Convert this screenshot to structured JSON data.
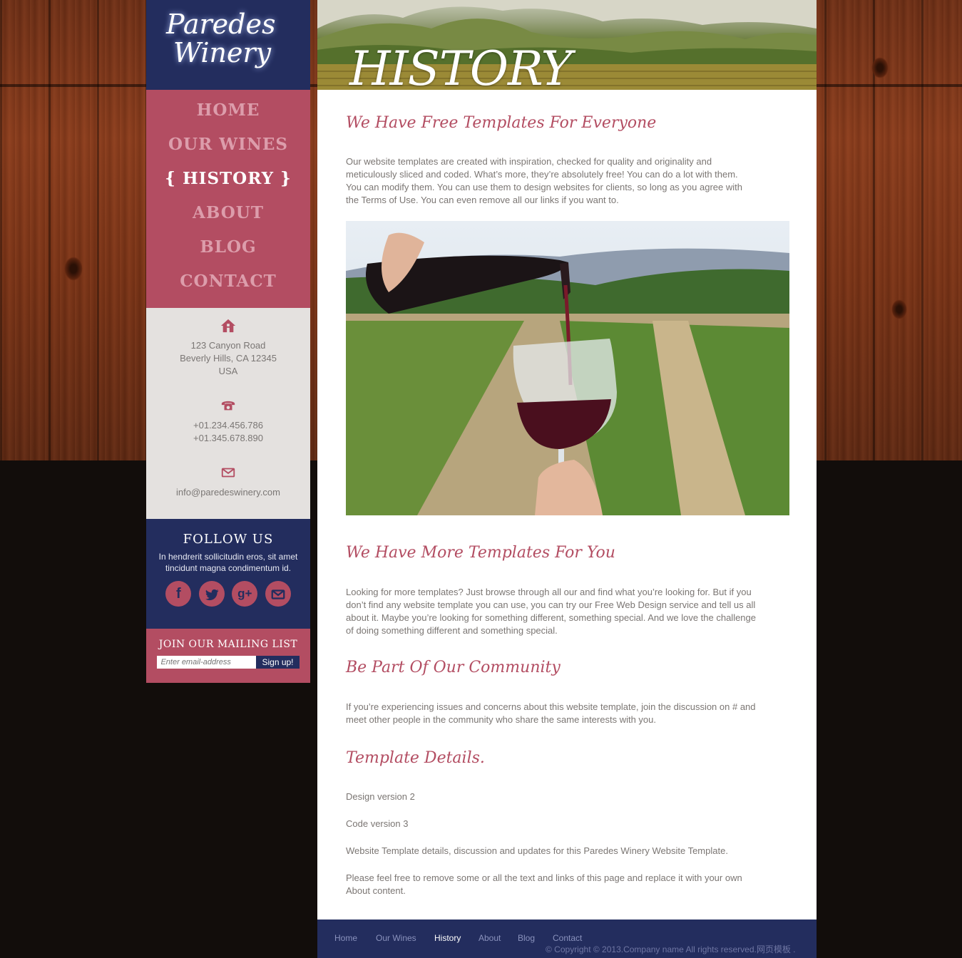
{
  "logo": {
    "line1": "Paredes",
    "line2": "Winery"
  },
  "nav": {
    "items": [
      {
        "label": "HOME"
      },
      {
        "label": "OUR WINES"
      },
      {
        "label": "{ HISTORY }"
      },
      {
        "label": "ABOUT"
      },
      {
        "label": "BLOG"
      },
      {
        "label": "CONTACT"
      }
    ]
  },
  "contact": {
    "address": [
      "123 Canyon Road",
      "Beverly Hills, CA 12345",
      "USA"
    ],
    "phones": [
      "+01.234.456.786",
      "+01.345.678.890"
    ],
    "email": "info@paredeswinery.com"
  },
  "follow": {
    "title": "FOLLOW US",
    "text": "In hendrerit sollicitudin eros, sit amet tincidunt magna condimentum id.",
    "icons": [
      "facebook-icon",
      "twitter-icon",
      "google-plus-icon",
      "mail-icon"
    ]
  },
  "mailing": {
    "title": "JOIN OUR MAILING LIST",
    "placeholder": "Enter email-address",
    "button": "Sign up!"
  },
  "banner": {
    "title": "HISTORY"
  },
  "sections": [
    {
      "heading": "We Have Free Templates For Everyone",
      "body": "Our website templates are created with inspiration, checked for quality and originality and meticulously sliced and coded. What’s more, they’re absolutely free! You can do a lot with them. You can modify them. You can use them to design websites for clients, so long as you agree with the Terms of Use. You can even remove all our links if you want to."
    },
    {
      "heading": "We Have More Templates For You",
      "body": "Looking for more templates? Just browse through all our and find what you’re looking for. But if you don’t find any website template you can use, you can try our Free Web Design service and tell us all about it. Maybe you’re looking for something different, something special. And we love the challenge of doing something different and something special."
    },
    {
      "heading": "Be Part Of Our Community",
      "body": "If you’re experiencing issues and concerns about this website template, join the discussion on # and meet other people in the community who share the same interests with you."
    },
    {
      "heading": "Template Details.",
      "lines": [
        "Design version 2",
        "Code version 3",
        "Website Template details, discussion and updates for this Paredes Winery Website Template.",
        "Please feel free to remove some or all the text and links of this page and replace it with your own About content."
      ]
    }
  ],
  "footer": {
    "links": [
      "Home",
      "Our Wines",
      "History",
      "About",
      "Blog",
      "Contact"
    ],
    "copyright": "© Copyright © 2013.Company name All rights reserved.网页模板 ."
  },
  "colors": {
    "navy": "#232d5e",
    "rose": "#b34d62",
    "light": "#e4e1df"
  }
}
